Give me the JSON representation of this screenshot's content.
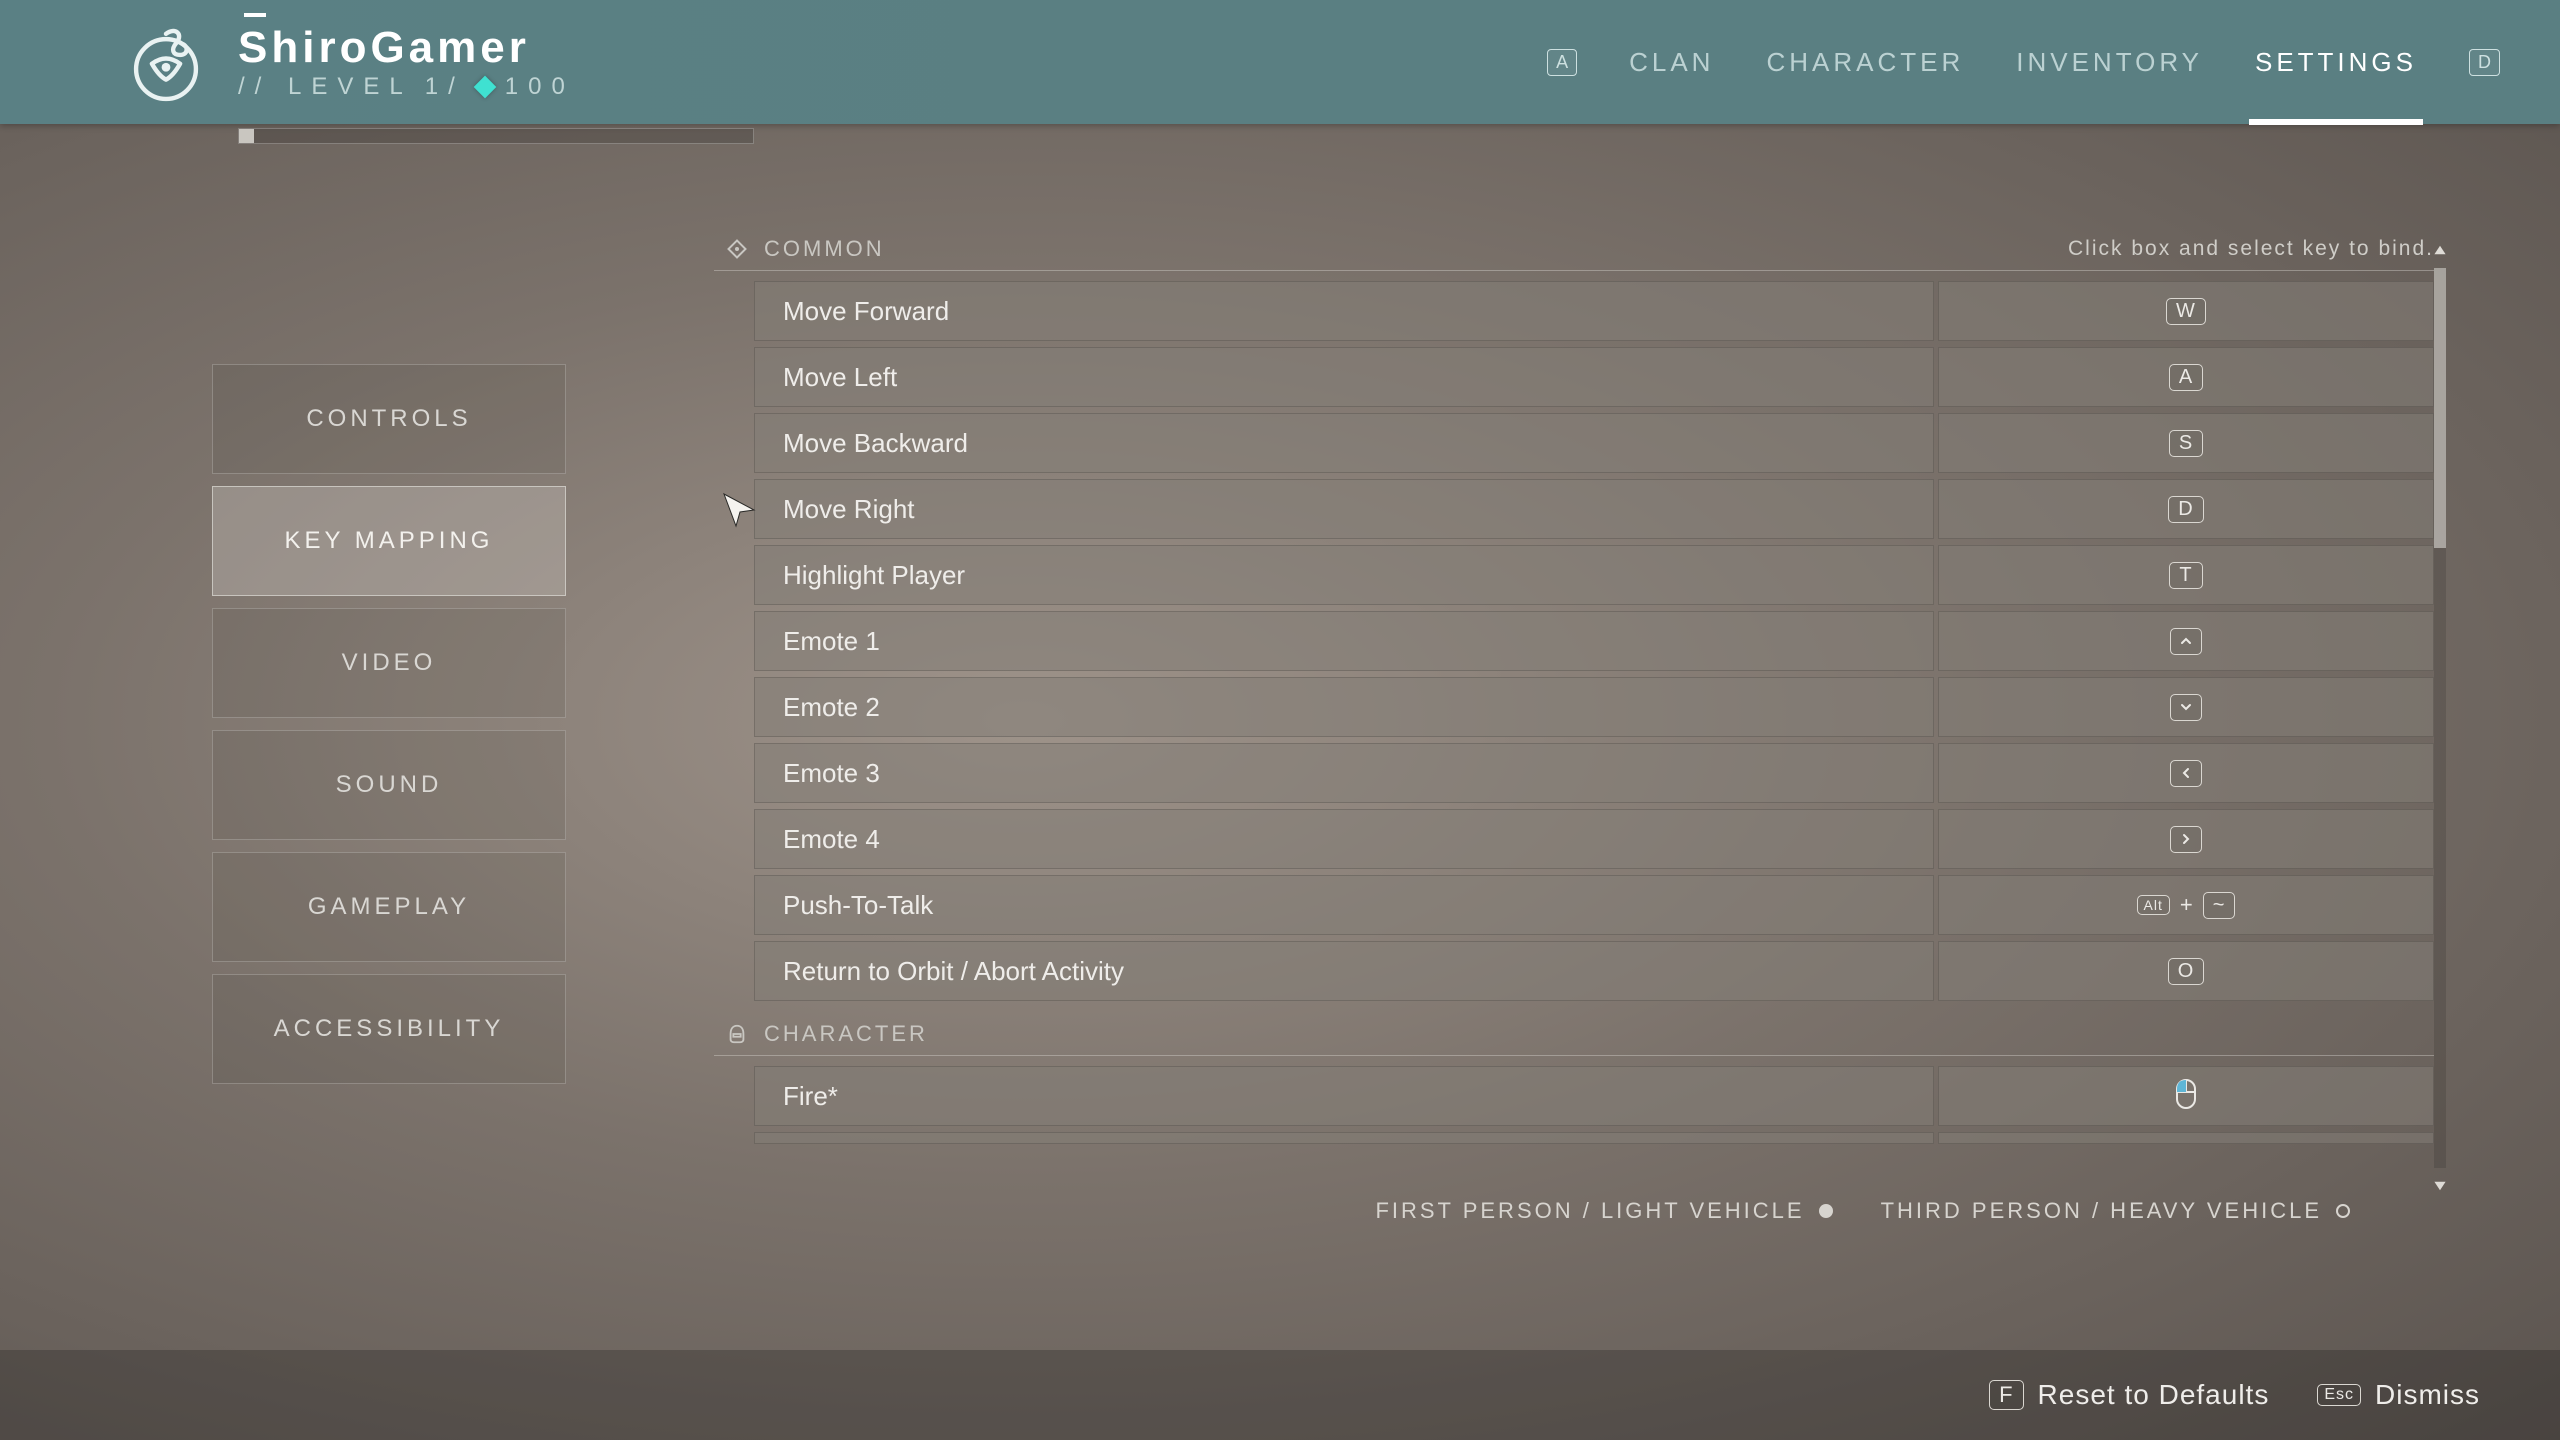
{
  "header": {
    "player_name": "ShiroGamer",
    "level_prefix": "// LEVEL",
    "level_value": "1/",
    "light_value": "100",
    "nav": {
      "prev_hint": "A",
      "next_hint": "D",
      "items": [
        "CLAN",
        "CHARACTER",
        "INVENTORY",
        "SETTINGS"
      ],
      "active_index": 3
    }
  },
  "sidebar": {
    "items": [
      "CONTROLS",
      "KEY MAPPING",
      "VIDEO",
      "SOUND",
      "GAMEPLAY",
      "ACCESSIBILITY"
    ],
    "active_index": 1
  },
  "content": {
    "helper_text": "Click box and select key to bind.",
    "sections": [
      {
        "title": "COMMON",
        "icon": "diamond-icon",
        "rows": [
          {
            "label": "Move Forward",
            "key": "W",
            "type": "key"
          },
          {
            "label": "Move Left",
            "key": "A",
            "type": "key"
          },
          {
            "label": "Move Backward",
            "key": "S",
            "type": "key"
          },
          {
            "label": "Move Right",
            "key": "D",
            "type": "key"
          },
          {
            "label": "Highlight Player",
            "key": "T",
            "type": "key"
          },
          {
            "label": "Emote 1",
            "key": "↑",
            "type": "arrow-up"
          },
          {
            "label": "Emote 2",
            "key": "↓",
            "type": "arrow-down"
          },
          {
            "label": "Emote 3",
            "key": "←",
            "type": "arrow-left"
          },
          {
            "label": "Emote 4",
            "key": "→",
            "type": "arrow-right"
          },
          {
            "label": "Push-To-Talk",
            "key": "Alt + ~",
            "type": "combo",
            "parts": [
              "Alt",
              "~"
            ]
          },
          {
            "label": "Return to Orbit / Abort Activity",
            "key": "O",
            "type": "key"
          }
        ]
      },
      {
        "title": "CHARACTER",
        "icon": "helmet-icon",
        "rows": [
          {
            "label": "Fire*",
            "key": "mouse-left",
            "type": "mouse"
          }
        ]
      }
    ],
    "legend": {
      "first": "FIRST PERSON / LIGHT VEHICLE",
      "third": "THIRD PERSON / HEAVY VEHICLE"
    }
  },
  "footer": {
    "reset_key": "F",
    "reset_label": "Reset to Defaults",
    "dismiss_key": "Esc",
    "dismiss_label": "Dismiss"
  }
}
